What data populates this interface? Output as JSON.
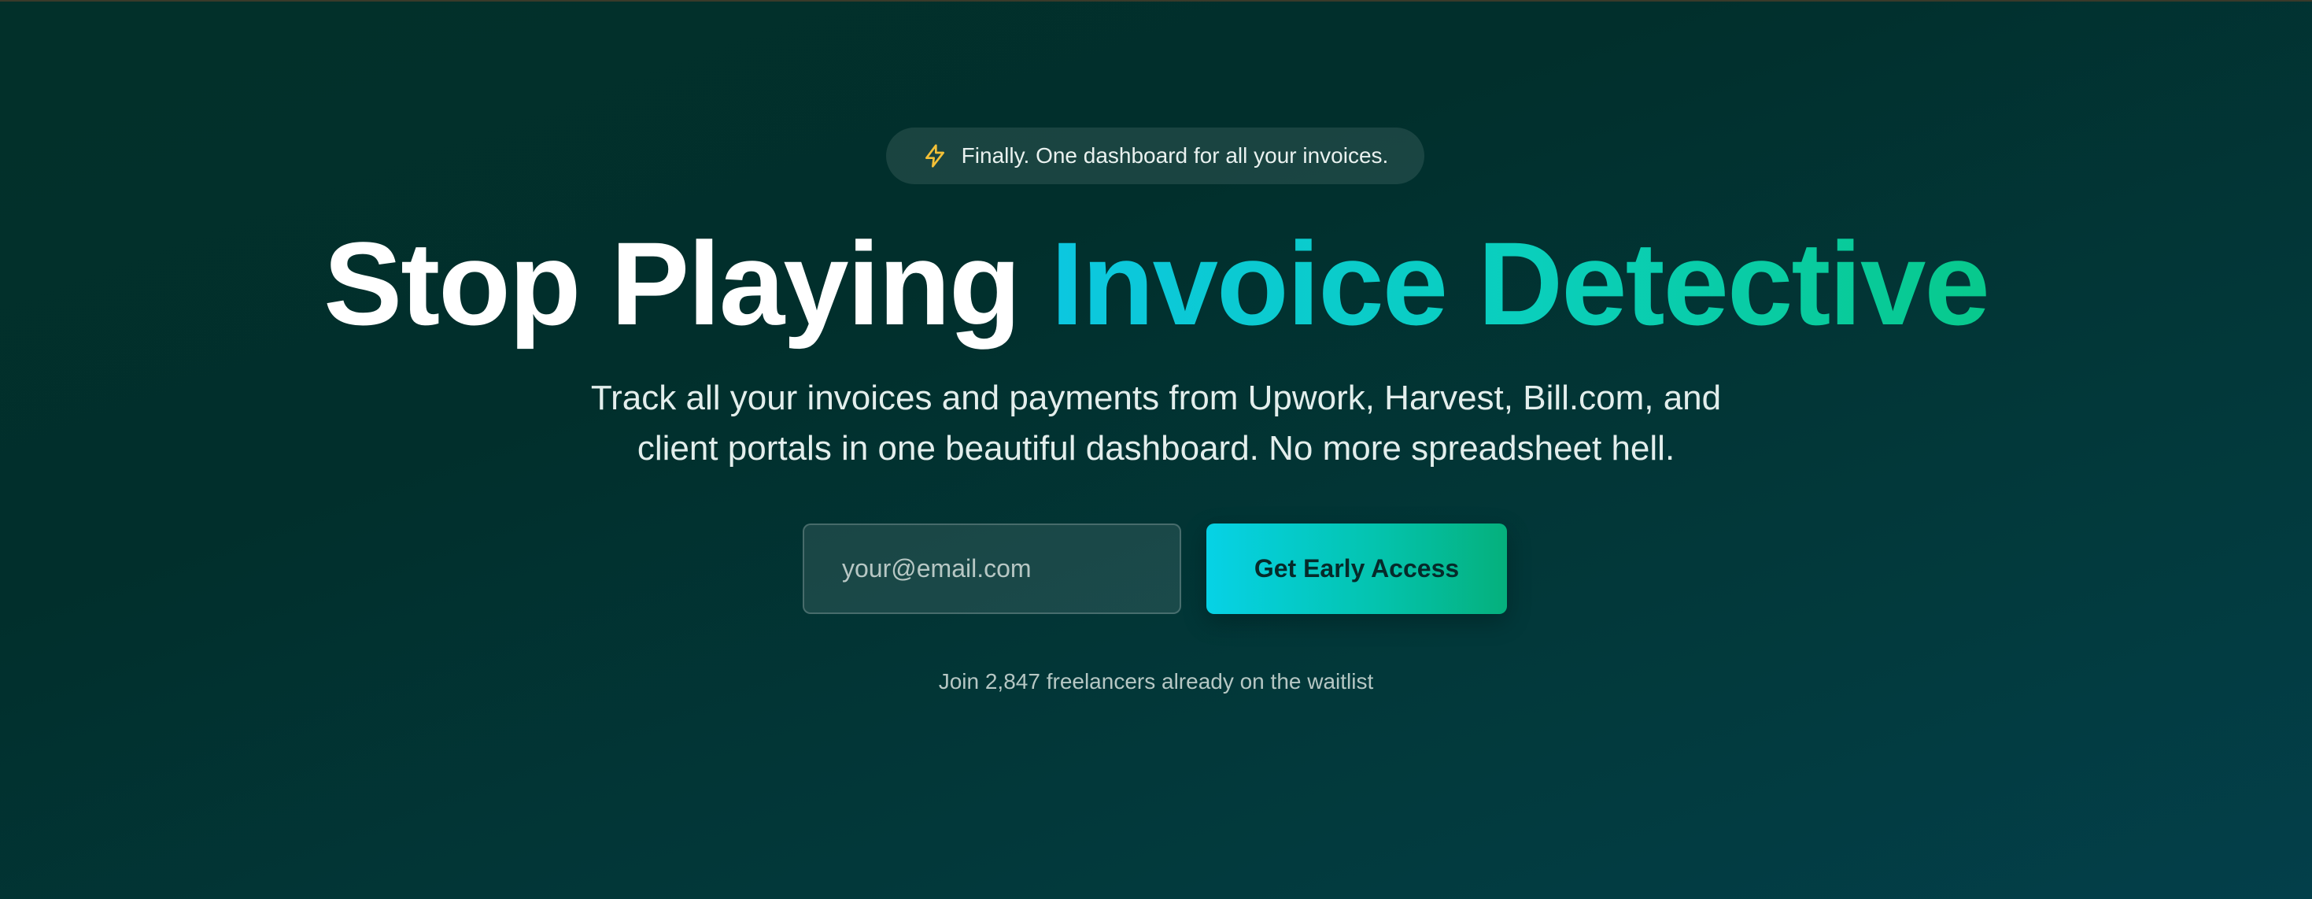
{
  "badge": {
    "icon": "lightning-bolt-icon",
    "text": "Finally. One dashboard for all your invoices.",
    "icon_color": "#f2c037"
  },
  "headline": {
    "plain": "Stop Playing",
    "highlight": "Invoice Detective"
  },
  "subtitle": {
    "line1": "Track all your invoices and payments from Upwork, Harvest, Bill.com, and",
    "line2": "client portals in one beautiful dashboard. No more spreadsheet hell."
  },
  "signup": {
    "email_placeholder": "your@email.com",
    "email_value": "",
    "button_label": "Get Early Access"
  },
  "waitlist": {
    "text": "Join 2,847 freelancers already on the waitlist"
  },
  "colors": {
    "accent_start": "#0cc7e0",
    "accent_end": "#08c98c",
    "background": "#02302a"
  }
}
